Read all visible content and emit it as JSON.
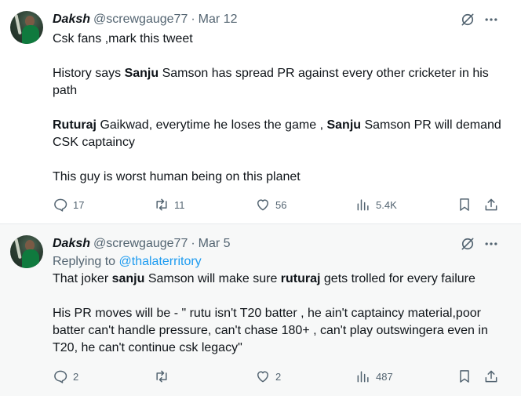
{
  "tweets": [
    {
      "name": "Daksh",
      "handle": "@screwgauge77",
      "sep": "·",
      "date": "Mar 12",
      "lines": {
        "l1": "Csk fans ,mark this tweet",
        "l2a": "History says ",
        "l2b": "Sanju",
        "l2c": " Samson has spread PR against every other cricketer in his path",
        "l3a": "Ruturaj",
        "l3b": " Gaikwad, everytime he loses the game , ",
        "l3c": "Sanju",
        "l3d": " Samson PR will demand CSK captaincy",
        "l4": "This guy is worst human being on this planet"
      },
      "stats": {
        "replies": "17",
        "retweets": "11",
        "likes": "56",
        "views": "5.4K"
      }
    },
    {
      "name": "Daksh",
      "handle": "@screwgauge77",
      "sep": "·",
      "date": "Mar 5",
      "replying_label": "Replying to ",
      "replying_handle": "@thalaterritory",
      "lines": {
        "l1a": "That joker ",
        "l1b": "sanju",
        "l1c": " Samson will make sure ",
        "l1d": "ruturaj",
        "l1e": " gets trolled for every failure",
        "l2": "His PR moves will be - \" rutu isn't T20 batter , he ain't captaincy material,poor batter can't handle pressure, can't chase 180+ , can't play outswingera even in T20, he can't continue csk legacy\""
      },
      "stats": {
        "replies": "2",
        "retweets": "",
        "likes": "2",
        "views": "487"
      }
    }
  ],
  "icons": {
    "grok": "grok-icon",
    "more": "more-icon",
    "reply": "reply-icon",
    "retweet": "retweet-icon",
    "like": "heart-icon",
    "views": "views-icon",
    "bookmark": "bookmark-icon",
    "share": "share-icon"
  },
  "colors": {
    "secondary_text": "#536471",
    "link": "#1d9bf0",
    "text": "#0f1419"
  }
}
